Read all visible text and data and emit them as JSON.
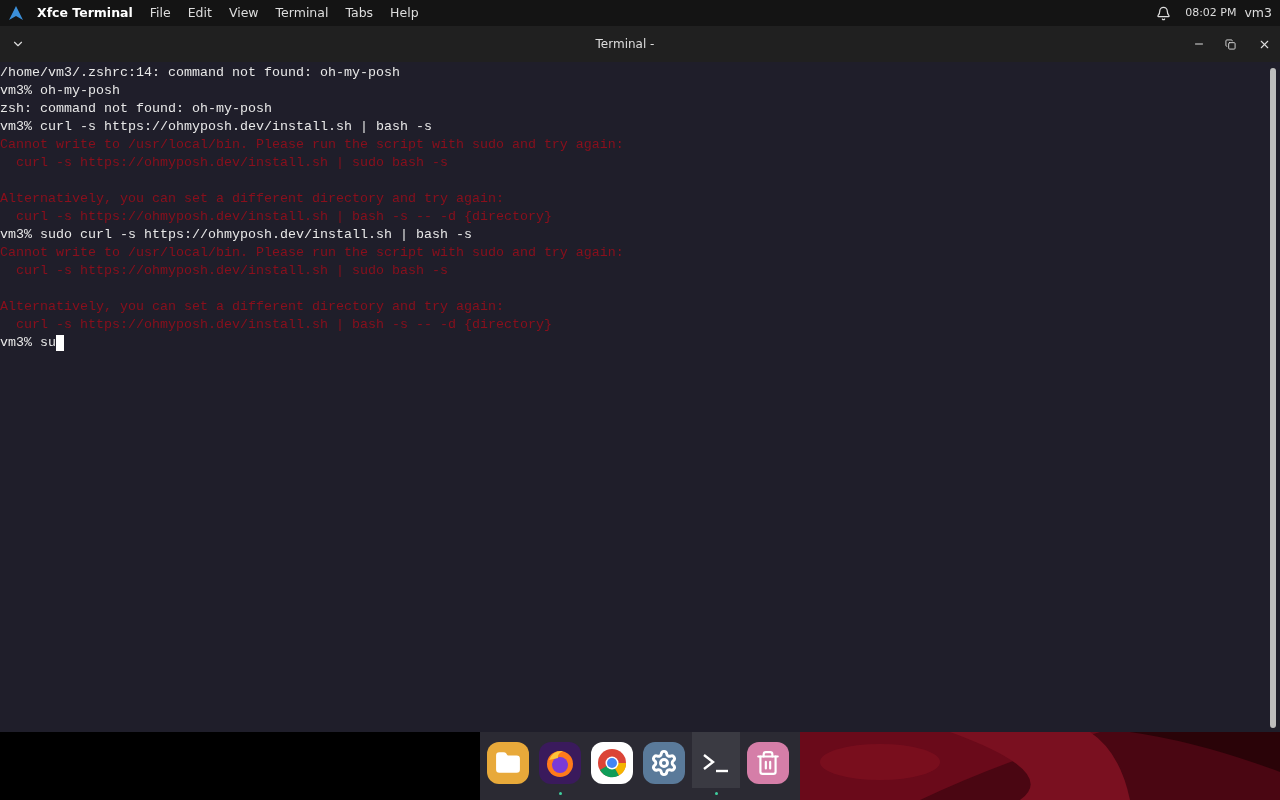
{
  "top_bar": {
    "app_name": "Xfce Terminal",
    "menu": [
      "File",
      "Edit",
      "View",
      "Terminal",
      "Tabs",
      "Help"
    ],
    "clock": "08:02 PM",
    "user": "vm3"
  },
  "window": {
    "title": "Terminal -"
  },
  "terminal": {
    "lines": [
      {
        "kind": "output",
        "text": "/home/vm3/.zshrc:14: command not found: oh-my-posh"
      },
      {
        "kind": "prompt",
        "prompt": "vm3%",
        "text": "oh-my-posh"
      },
      {
        "kind": "output",
        "text": "zsh: command not found: oh-my-posh"
      },
      {
        "kind": "prompt",
        "prompt": "vm3%",
        "text": "curl -s https://ohmyposh.dev/install.sh | bash -s"
      },
      {
        "kind": "error",
        "text": "Cannot write to /usr/local/bin. Please run the script with sudo and try again:"
      },
      {
        "kind": "error",
        "text": "  curl -s https://ohmyposh.dev/install.sh | sudo bash -s"
      },
      {
        "kind": "blank"
      },
      {
        "kind": "error",
        "text": "Alternatively, you can set a different directory and try again:"
      },
      {
        "kind": "error",
        "text": "  curl -s https://ohmyposh.dev/install.sh | bash -s -- -d {directory}"
      },
      {
        "kind": "prompt",
        "prompt": "vm3%",
        "text": "sudo curl -s https://ohmyposh.dev/install.sh | bash -s"
      },
      {
        "kind": "error",
        "text": "Cannot write to /usr/local/bin. Please run the script with sudo and try again:"
      },
      {
        "kind": "error",
        "text": "  curl -s https://ohmyposh.dev/install.sh | sudo bash -s"
      },
      {
        "kind": "blank"
      },
      {
        "kind": "error",
        "text": "Alternatively, you can set a different directory and try again:"
      },
      {
        "kind": "error",
        "text": "  curl -s https://ohmyposh.dev/install.sh | bash -s -- -d {directory}"
      },
      {
        "kind": "input",
        "prompt": "vm3%",
        "text": "su"
      }
    ]
  },
  "dock": [
    {
      "kind": "files",
      "running": false,
      "active": false
    },
    {
      "kind": "firefox",
      "running": true,
      "active": false
    },
    {
      "kind": "chrome",
      "running": false,
      "active": false
    },
    {
      "kind": "settings",
      "running": false,
      "active": false
    },
    {
      "kind": "terminal",
      "running": true,
      "active": true
    },
    {
      "kind": "trash",
      "running": false,
      "active": false
    }
  ]
}
